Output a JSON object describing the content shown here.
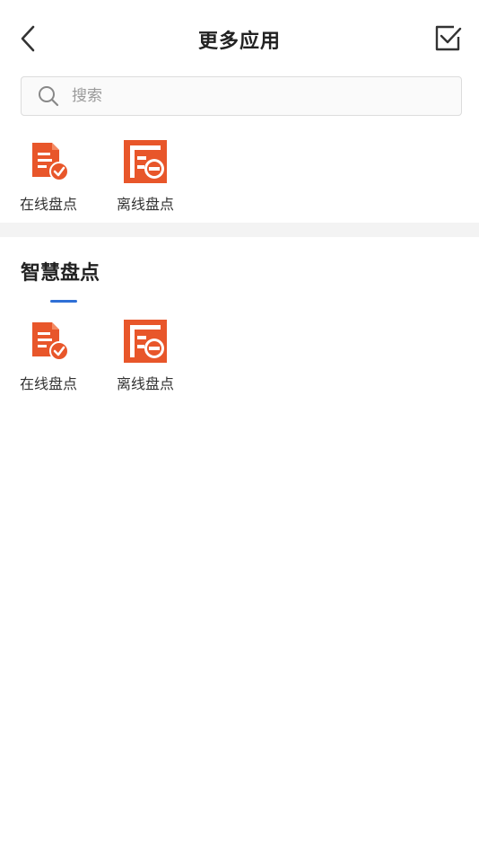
{
  "header": {
    "title": "更多应用",
    "back_icon": "chevron-left-icon",
    "action_icon": "checkbox-checked-icon"
  },
  "search": {
    "placeholder": "搜索",
    "value": ""
  },
  "top_apps": [
    {
      "label": "在线盘点",
      "icon": "online-inventory-icon"
    },
    {
      "label": "离线盘点",
      "icon": "offline-inventory-icon"
    }
  ],
  "section": {
    "title": "智慧盘点",
    "apps": [
      {
        "label": "在线盘点",
        "icon": "online-inventory-icon"
      },
      {
        "label": "离线盘点",
        "icon": "offline-inventory-icon"
      }
    ]
  },
  "colors": {
    "accent": "#2f6fd6",
    "icon_orange": "#e8562a",
    "text": "#333333"
  }
}
